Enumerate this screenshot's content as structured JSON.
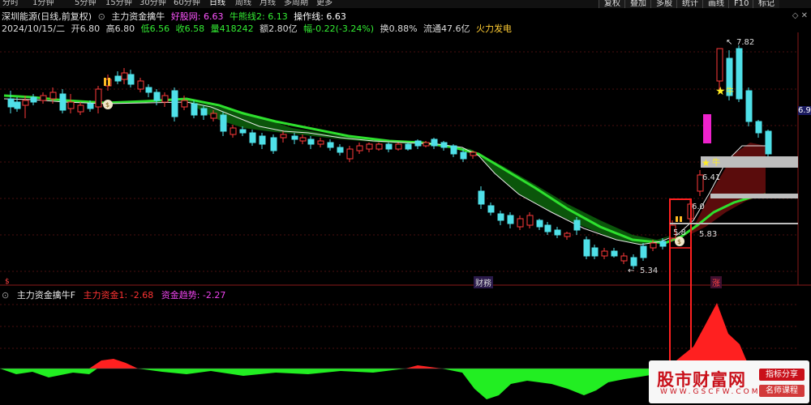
{
  "toolbar": {
    "periods": [
      "分时",
      "1分钟",
      "5分钟",
      "15分钟",
      "30分钟",
      "60分钟",
      "日线",
      "周线",
      "月线",
      "多周期",
      "更多"
    ],
    "active_period": "日线",
    "right_buttons": [
      "复权",
      "叠加",
      "多股",
      "统计",
      "画线",
      "F10",
      "标记"
    ]
  },
  "info": {
    "stock": "深圳能源(日线,前复权)",
    "indicator": "主力资金擒牛",
    "lines": {
      "hao": "好股网: 6.63",
      "niu": "牛熊线2: 6.13",
      "op": "操作线: 6.63"
    },
    "date": "2024/10/15/二",
    "open": "开6.80",
    "high": "高6.80",
    "low": "低6.56",
    "close": "收6.58",
    "volume": "量418242",
    "amount": "额2.80亿",
    "change": "幅-0.22(-3.24%)",
    "turnover": "换0.88%",
    "float": "流通47.6亿",
    "concept": "火力发电"
  },
  "price_labels": {
    "high": "7.82",
    "low": "5.34",
    "lbl_641": "6.41",
    "lbl_60": "6.0",
    "lbl_58": "5.8",
    "lbl_583": "5.83",
    "right_axis": "6.9"
  },
  "markers": {
    "fin": "财務",
    "up": "涨",
    "bull": "牛",
    "s_left": "$"
  },
  "sub_panel": {
    "name": "主力资金擒牛F",
    "fund": "主力资金1: -2.68",
    "trend": "资金趋势: -2.27"
  },
  "watermark": {
    "title": "股市财富网",
    "url": "WWW.GSCFW.COM",
    "btn1": "指标分享",
    "btn2": "名师课程"
  },
  "colors": {
    "up": "#ff3a3a",
    "down": "#4fe0e8",
    "green_line": "#2ee02e",
    "white_line": "#e8e8e8",
    "fund_pos": "#ff2020",
    "fund_neg": "#22ee22",
    "highlight_box": "#ff2020",
    "purple_bar": "#ee22cc"
  }
}
